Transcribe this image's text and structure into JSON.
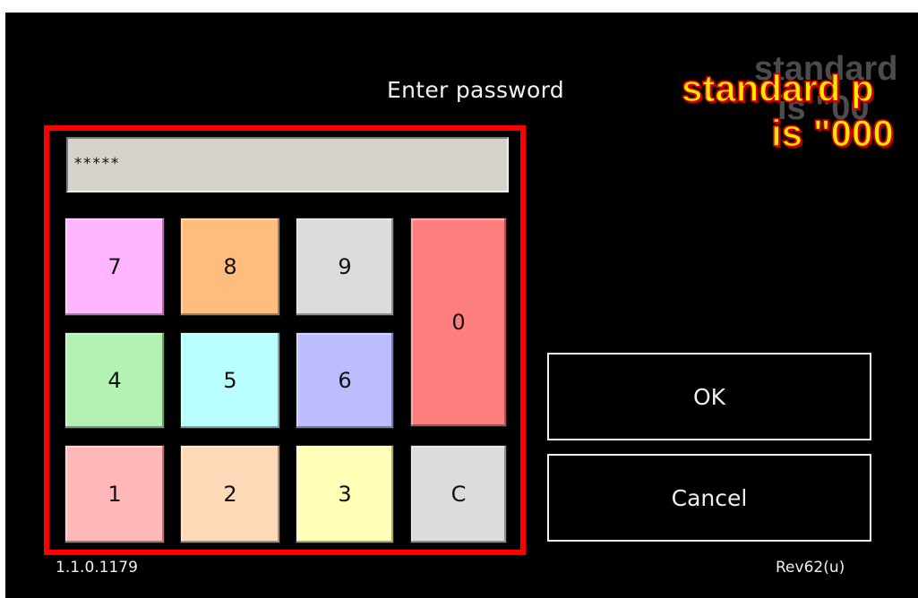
{
  "header": {
    "title": "Enter password"
  },
  "annotation": {
    "line1": "standard p",
    "line2": "is \"000",
    "ghost_line1": "standard",
    "ghost_line2": "is \"00",
    "color": "#ffe800",
    "outline_color": "#d40000"
  },
  "password_field": {
    "value": "*****"
  },
  "keypad": {
    "frame_color": "#ff0000",
    "keys": {
      "k7": "7",
      "k8": "8",
      "k9": "9",
      "k0": "0",
      "k4": "4",
      "k5": "5",
      "k6": "6",
      "k1": "1",
      "k2": "2",
      "k3": "3",
      "clear": "C"
    }
  },
  "actions": {
    "ok_label": "OK",
    "cancel_label": "Cancel"
  },
  "footer": {
    "version": "1.1.0.1179",
    "revision": "Rev62(u)"
  }
}
